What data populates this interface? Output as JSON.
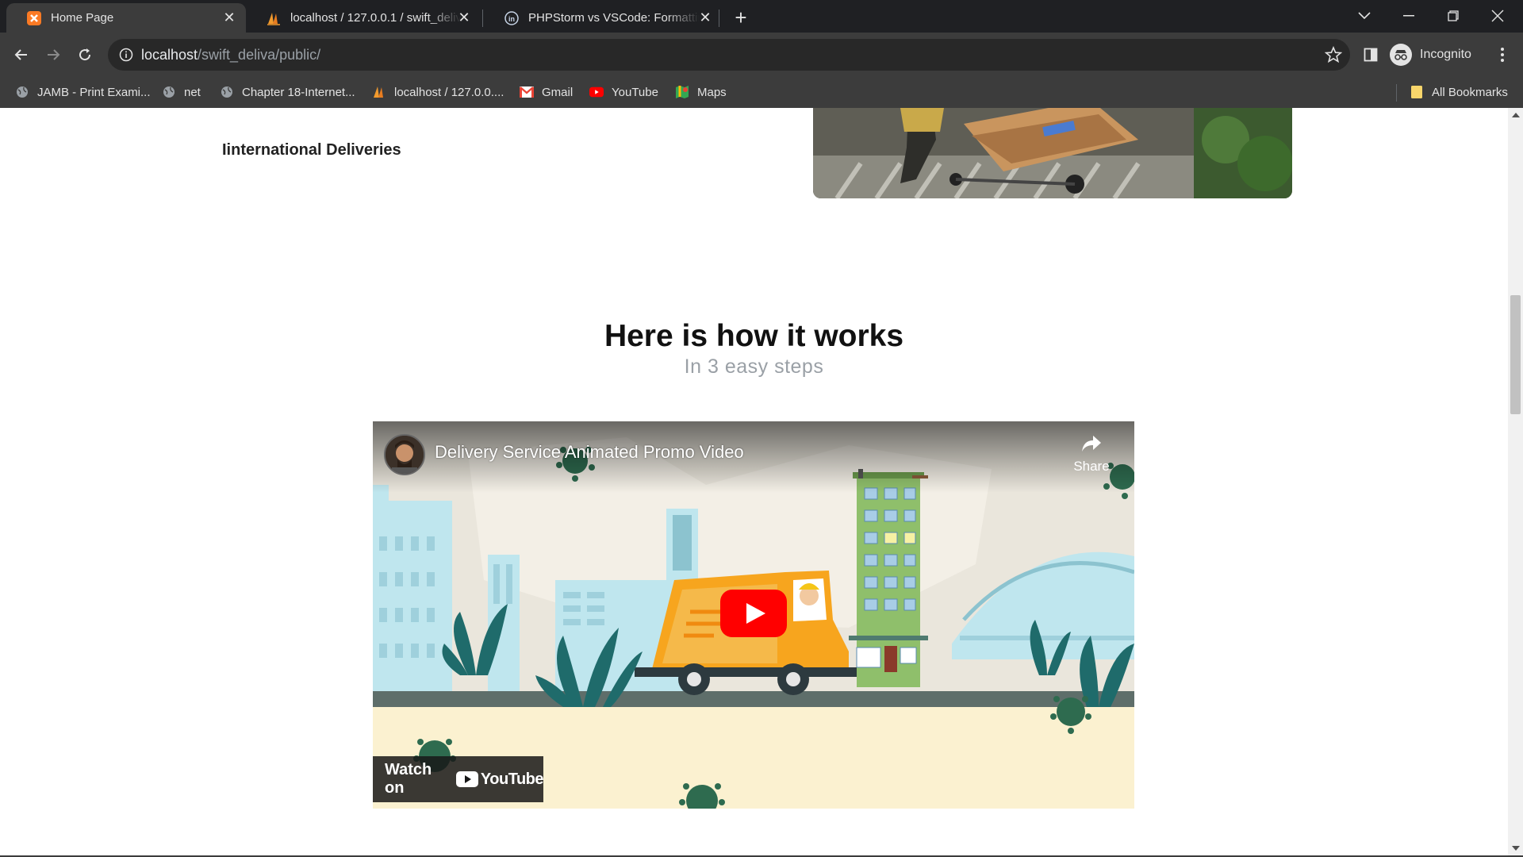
{
  "browser": {
    "tabs": [
      {
        "title": "Home Page",
        "icon": "xampp-icon",
        "active": true
      },
      {
        "title": "localhost / 127.0.0.1 / swift_deliv",
        "icon": "phpmyadmin-icon",
        "active": false
      },
      {
        "title": "PHPStorm vs VSCode: Formattin",
        "icon": "linkedin-icon",
        "active": false
      }
    ],
    "url_host": "localhost",
    "url_path": "/swift_deliva/public/",
    "profile_label": "Incognito",
    "bookmarks": [
      {
        "label": "JAMB - Print Exami...",
        "icon": "globe-icon"
      },
      {
        "label": "net",
        "icon": "globe-icon"
      },
      {
        "label": "Chapter 18-Internet...",
        "icon": "globe-icon"
      },
      {
        "label": "localhost / 127.0.0....",
        "icon": "phpmyadmin-icon"
      },
      {
        "label": "Gmail",
        "icon": "gmail-icon"
      },
      {
        "label": "YouTube",
        "icon": "youtube-icon"
      },
      {
        "label": "Maps",
        "icon": "maps-icon"
      }
    ],
    "all_bookmarks_label": "All Bookmarks"
  },
  "page": {
    "service_label": "Iinternational Deliveries",
    "how_title": "Here is how it works",
    "how_subtitle": "In 3 easy steps"
  },
  "video": {
    "title": "Delivery Service Animated Promo Video",
    "share_label": "Share",
    "watch_on_label": "Watch on",
    "youtube_label": "YouTube"
  },
  "colors": {
    "chrome_dark": "#1f2023",
    "chrome_toolbar": "#3c3c3c",
    "youtube_red": "#ff0000",
    "truck_orange": "#f7a51e",
    "building_green": "#8fbf6b",
    "sky_blue": "#bfe6ee"
  }
}
